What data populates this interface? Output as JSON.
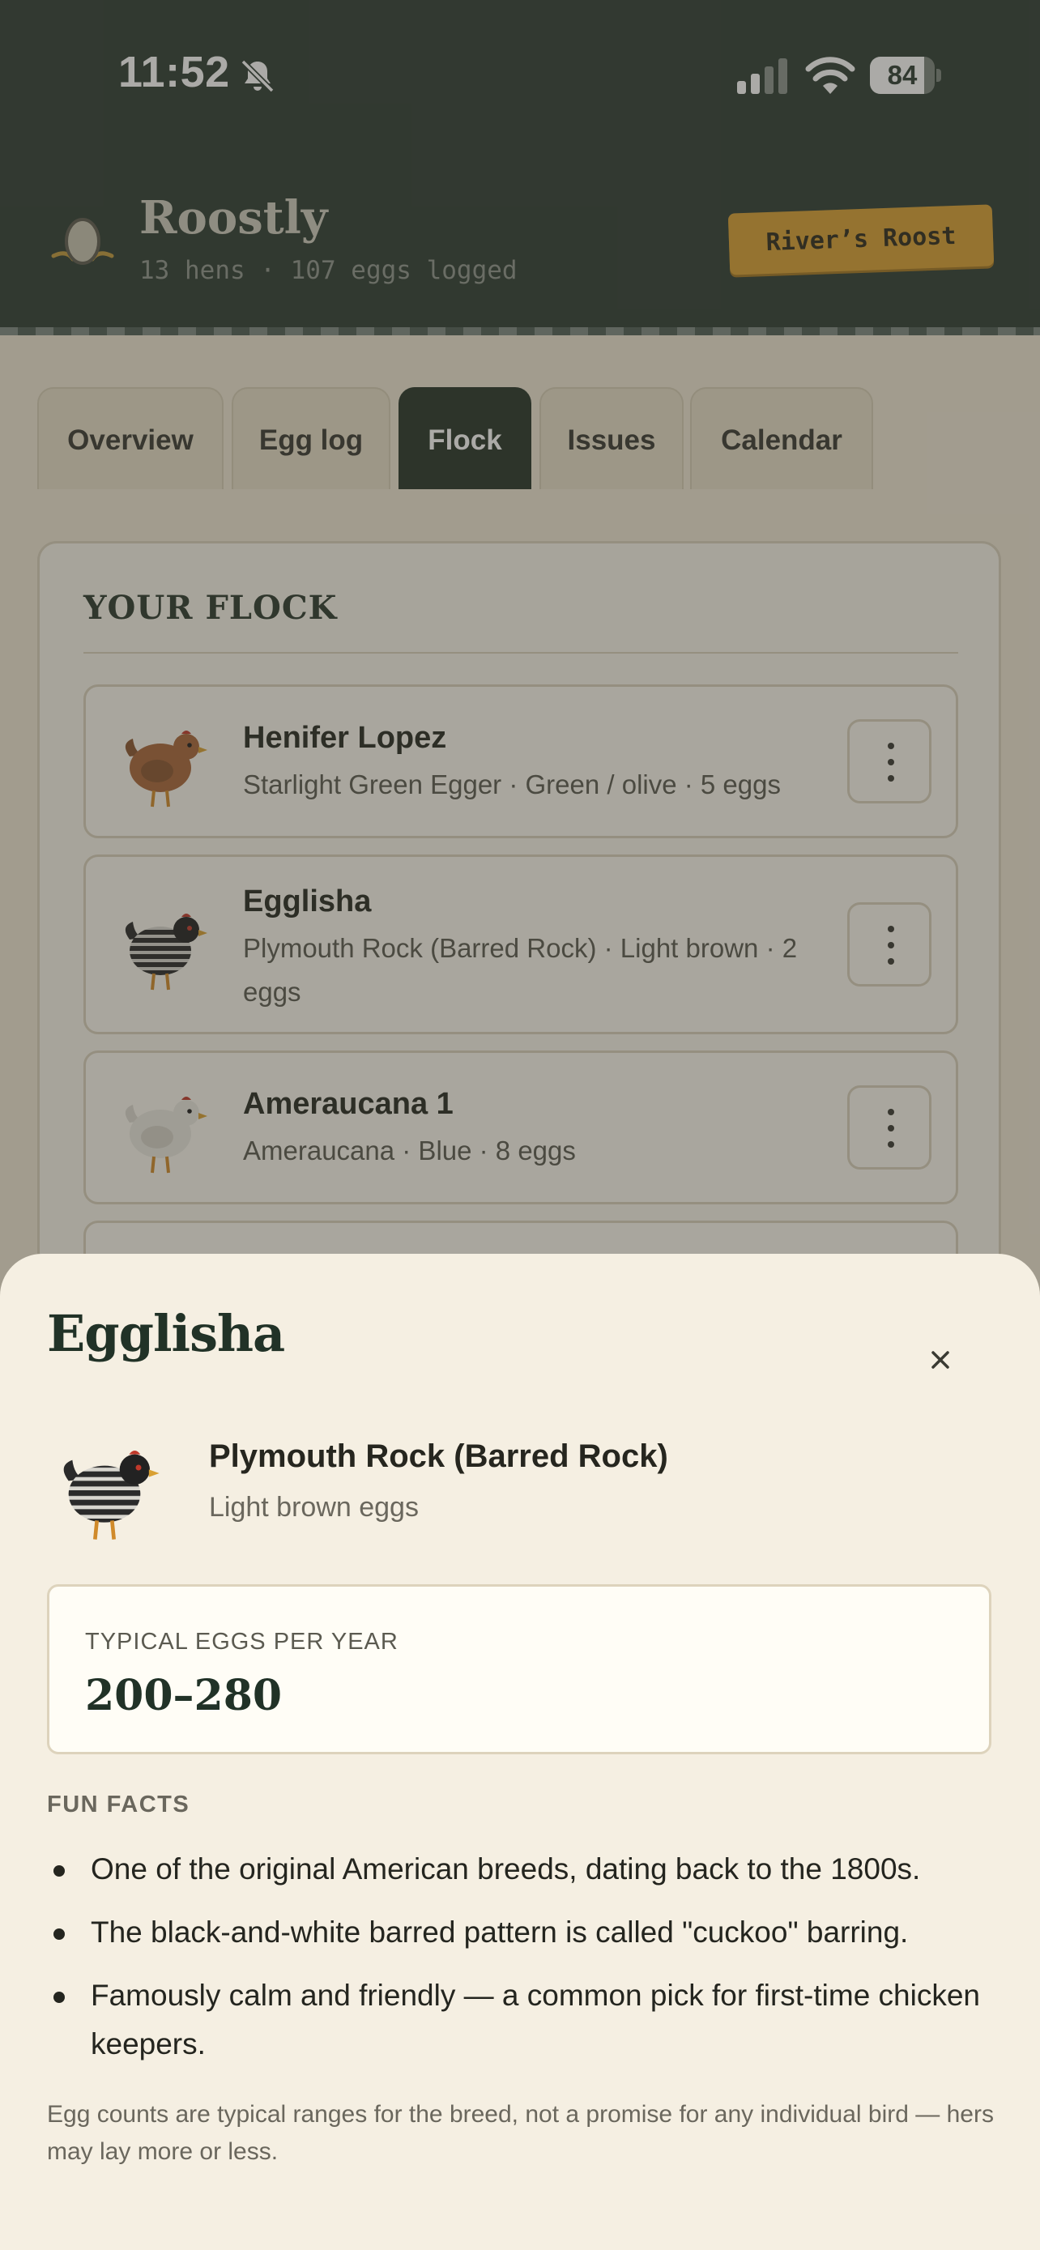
{
  "status_bar": {
    "time": "11:52",
    "battery": "84",
    "battery_level": 0.84
  },
  "header": {
    "app_name": "Roostly",
    "subtitle": "13 hens · 107 eggs logged",
    "roost_badge": "River’s Roost"
  },
  "tabs": [
    {
      "label": "Overview",
      "active": false
    },
    {
      "label": "Egg log",
      "active": false
    },
    {
      "label": "Flock",
      "active": true
    },
    {
      "label": "Issues",
      "active": false
    },
    {
      "label": "Calendar",
      "active": false
    }
  ],
  "flock": {
    "heading": "YOUR FLOCK",
    "hens": [
      {
        "name": "Henifer Lopez",
        "meta": "Starlight Green Egger · Green / olive · 5 eggs",
        "avatar": "brown-hen-icon"
      },
      {
        "name": "Egglisha",
        "meta": "Plymouth Rock (Barred Rock) · Light brown · 2 eggs",
        "avatar": "barred-hen-icon"
      },
      {
        "name": "Ameraucana 1",
        "meta": "Ameraucana · Blue · 8 eggs",
        "avatar": "white-hen-icon"
      }
    ]
  },
  "sheet": {
    "title": "Egglisha",
    "breed": "Plymouth Rock (Barred Rock)",
    "egg_color": "Light brown eggs",
    "stat_label": "TYPICAL EGGS PER YEAR",
    "stat_value": "200–280",
    "facts_heading": "FUN FACTS",
    "facts": [
      "One of the original American breeds, dating back to the 1800s.",
      "The black-and-white barred pattern is called \"cuckoo\" barring.",
      "Famously calm and friendly — a common pick for first-time chicken keepers."
    ],
    "footnote": "Egg counts are typical ranges for the breed, not a promise for any individual bird — hers may lay more or less."
  },
  "colors": {
    "header_bg": "#2e3d33",
    "accent_badge": "#d9a032",
    "active_tab": "#263529",
    "sheet_bg": "#f5efe2"
  }
}
